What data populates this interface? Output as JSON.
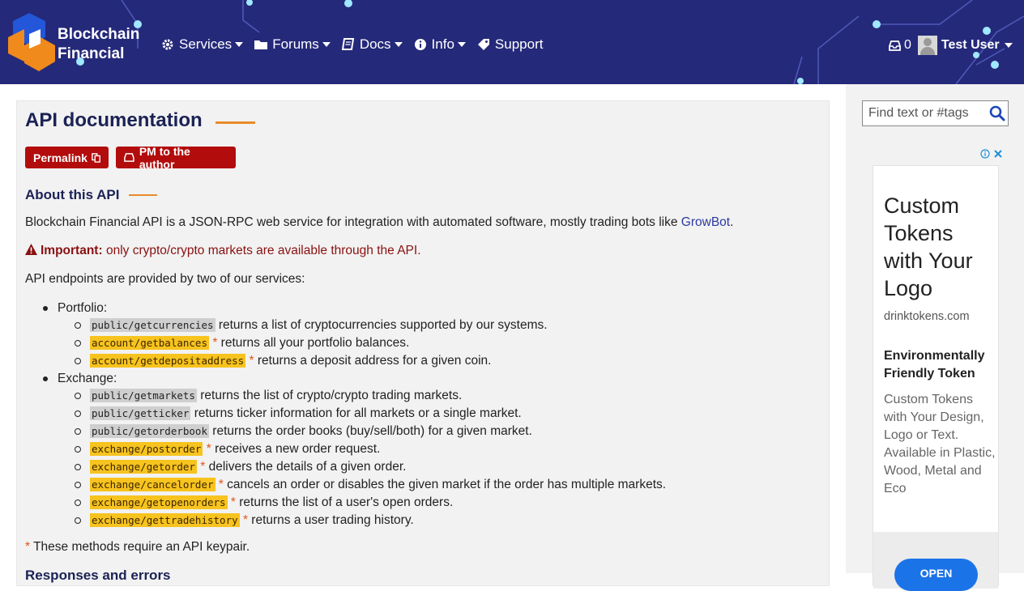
{
  "header": {
    "brand_line1": "Blockchain",
    "brand_line2": "Financial",
    "nav": [
      {
        "label": "Services",
        "icon": "gear-icon",
        "has_caret": true
      },
      {
        "label": "Forums",
        "icon": "folder-icon",
        "has_caret": true
      },
      {
        "label": "Docs",
        "icon": "book-icon",
        "has_caret": true
      },
      {
        "label": "Info",
        "icon": "info-icon",
        "has_caret": true
      },
      {
        "label": "Support",
        "icon": "tag-icon",
        "has_caret": false
      }
    ],
    "inbox_count": "0",
    "username": "Test User"
  },
  "page": {
    "title": "API documentation",
    "permalink_label": "Permalink",
    "pm_label": "PM to the author",
    "section_about": "About this API",
    "intro_text": "Blockchain Financial API is a JSON-RPC web service for integration with automated software, mostly trading bots like ",
    "intro_link": "GrowBot",
    "intro_end": ".",
    "important_label": "Important:",
    "important_text": " only crypto/crypto markets are available through the API.",
    "endpoints_intro": "API endpoints are provided by two of our services:",
    "groups": [
      {
        "name": "Portfolio:",
        "methods": [
          {
            "code": "public/getcurrencies",
            "private": false,
            "desc": " returns a list of cryptocurrencies supported by our systems."
          },
          {
            "code": "account/getbalances",
            "private": true,
            "desc": " returns all your portfolio balances."
          },
          {
            "code": "account/getdepositaddress",
            "private": true,
            "desc": " returns a deposit address for a given coin."
          }
        ]
      },
      {
        "name": "Exchange:",
        "methods": [
          {
            "code": "public/getmarkets",
            "private": false,
            "desc": " returns the list of crypto/crypto trading markets."
          },
          {
            "code": "public/getticker",
            "private": false,
            "desc": " returns ticker information for all markets or a single market."
          },
          {
            "code": "public/getorderbook",
            "private": false,
            "desc": " returns the order books (buy/sell/both) for a given market."
          },
          {
            "code": "exchange/postorder",
            "private": true,
            "desc": " receives a new order request."
          },
          {
            "code": "exchange/getorder",
            "private": true,
            "desc": " delivers the details of a given order."
          },
          {
            "code": "exchange/cancelorder",
            "private": true,
            "desc": " cancels an order or disables the given market if the order has multiple markets."
          },
          {
            "code": "exchange/getopenorders",
            "private": true,
            "desc": " returns the list of a user's open orders."
          },
          {
            "code": "exchange/gettradehistory",
            "private": true,
            "desc": " returns a user trading history."
          }
        ]
      }
    ],
    "footnote_star": "*",
    "footnote_text": " These methods require an API keypair.",
    "next_section": "Responses and errors"
  },
  "sidebar": {
    "search_placeholder": "Find text or #tags",
    "ad": {
      "title": "Custom Tokens with Your Logo",
      "domain": "drinktokens.com",
      "headline": "Environmentally Friendly Token",
      "body": "Custom Tokens with Your Design, Logo or Text. Available in Plastic, Wood, Metal and Eco",
      "cta": "OPEN"
    }
  },
  "colors": {
    "header_bg": "#25297a",
    "accent_orange": "#e98a2a",
    "button_red": "#b30c0c",
    "private_highlight": "#f7c31e"
  }
}
